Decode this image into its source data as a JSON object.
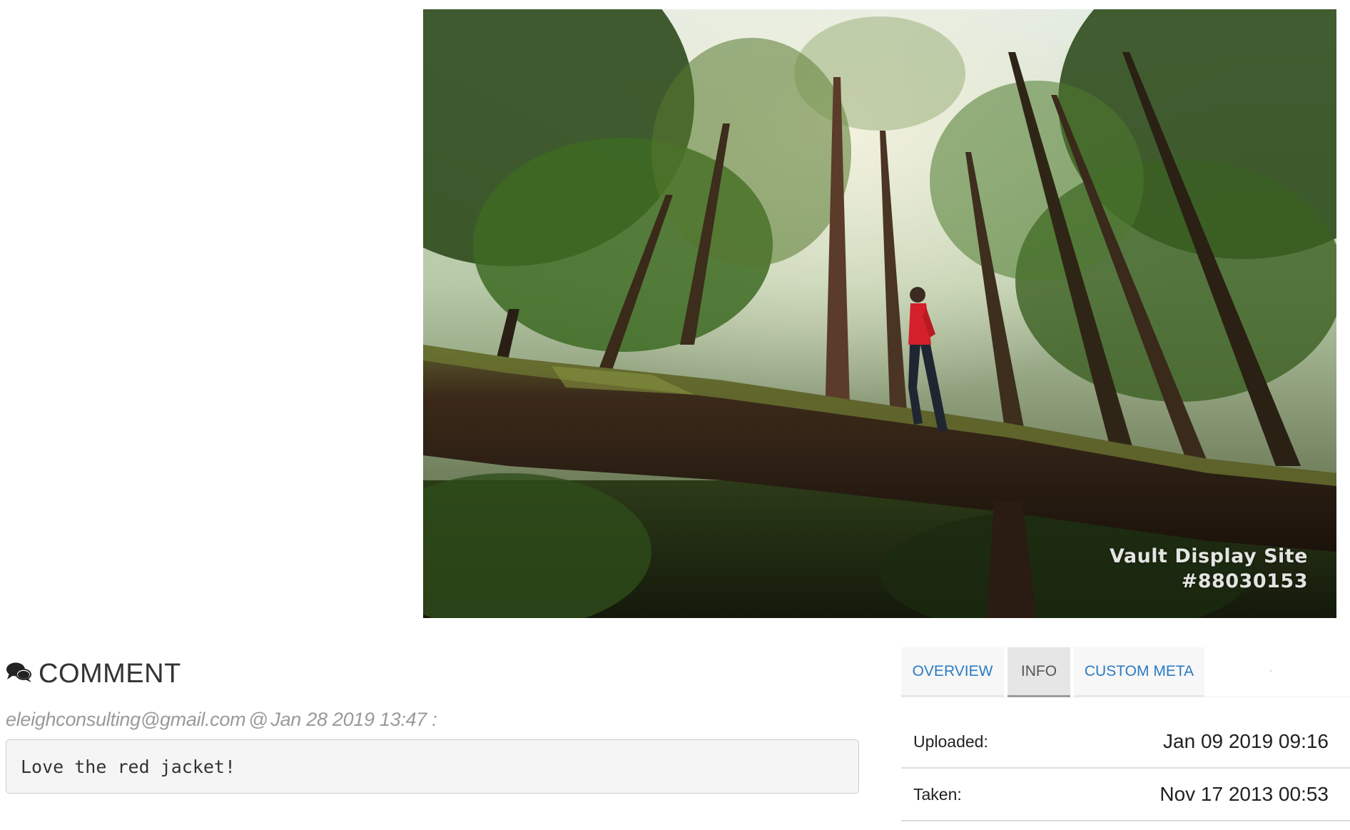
{
  "photo": {
    "watermark_line1": "Vault Display Site",
    "watermark_line2": "#88030153"
  },
  "comments": {
    "heading": "COMMENT",
    "icon": "comments-icon",
    "items": [
      {
        "author": "eleighconsulting@gmail.com",
        "separator": "@",
        "timestamp": "Jan 28 2019 13:47 :",
        "text": "Love the red jacket!"
      }
    ]
  },
  "info_panel": {
    "tabs": [
      {
        "label": "OVERVIEW",
        "active": false
      },
      {
        "label": "INFO",
        "active": true
      },
      {
        "label": "CUSTOM META",
        "active": false
      }
    ],
    "rows": [
      {
        "label": "Uploaded:",
        "value": "Jan 09 2019 09:16"
      },
      {
        "label": "Taken:",
        "value": "Nov 17 2013 00:53"
      }
    ]
  },
  "colors": {
    "link_blue": "#2b7bc2",
    "active_tab_bg": "#e6e6e6",
    "meta_gray": "#9a9a9a"
  }
}
